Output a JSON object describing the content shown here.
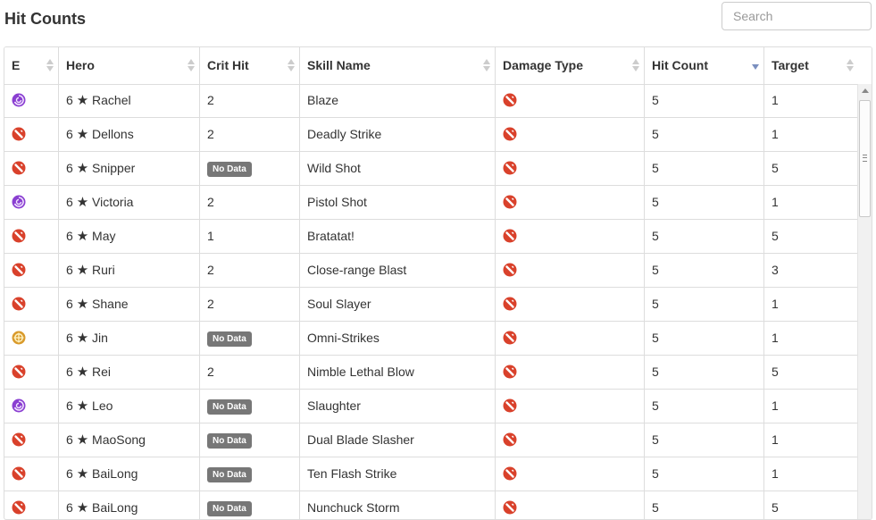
{
  "page": {
    "title": "Hit Counts"
  },
  "search": {
    "placeholder": "Search"
  },
  "columns": [
    {
      "key": "element",
      "label": "E"
    },
    {
      "key": "hero",
      "label": "Hero"
    },
    {
      "key": "crit",
      "label": "Crit Hit"
    },
    {
      "key": "skill",
      "label": "Skill Name"
    },
    {
      "key": "damage",
      "label": "Damage Type"
    },
    {
      "key": "hits",
      "label": "Hit Count",
      "sort": "desc"
    },
    {
      "key": "target",
      "label": "Target"
    }
  ],
  "element_icons": {
    "dark": {
      "icon": "dark-element-icon",
      "color": "#8a3fd1"
    },
    "physical": {
      "icon": "physical-element-icon",
      "color": "#d9412b"
    },
    "light": {
      "icon": "light-element-icon",
      "color": "#d99a2b"
    }
  },
  "damage_icon": {
    "icon": "physical-damage-icon",
    "color": "#d9412b"
  },
  "rows": [
    {
      "element": "dark",
      "stars": "6",
      "hero": "Rachel",
      "crit": "2",
      "skill": "Blaze",
      "hits": "5",
      "target": "1"
    },
    {
      "element": "physical",
      "stars": "6",
      "hero": "Dellons",
      "crit": "2",
      "skill": "Deadly Strike",
      "hits": "5",
      "target": "1"
    },
    {
      "element": "physical",
      "stars": "6",
      "hero": "Snipper",
      "crit": "No Data",
      "skill": "Wild Shot",
      "hits": "5",
      "target": "5"
    },
    {
      "element": "dark",
      "stars": "6",
      "hero": "Victoria",
      "crit": "2",
      "skill": "Pistol Shot",
      "hits": "5",
      "target": "1"
    },
    {
      "element": "physical",
      "stars": "6",
      "hero": "May",
      "crit": "1",
      "skill": "Bratatat!",
      "hits": "5",
      "target": "5"
    },
    {
      "element": "physical",
      "stars": "6",
      "hero": "Ruri",
      "crit": "2",
      "skill": "Close-range Blast",
      "hits": "5",
      "target": "3"
    },
    {
      "element": "physical",
      "stars": "6",
      "hero": "Shane",
      "crit": "2",
      "skill": "Soul Slayer",
      "hits": "5",
      "target": "1"
    },
    {
      "element": "light",
      "stars": "6",
      "hero": "Jin",
      "crit": "No Data",
      "skill": "Omni-Strikes",
      "hits": "5",
      "target": "1"
    },
    {
      "element": "physical",
      "stars": "6",
      "hero": "Rei",
      "crit": "2",
      "skill": "Nimble Lethal Blow",
      "hits": "5",
      "target": "5"
    },
    {
      "element": "dark",
      "stars": "6",
      "hero": "Leo",
      "crit": "No Data",
      "skill": "Slaughter",
      "hits": "5",
      "target": "1"
    },
    {
      "element": "physical",
      "stars": "6",
      "hero": "MaoSong",
      "crit": "No Data",
      "skill": "Dual Blade Slasher",
      "hits": "5",
      "target": "1"
    },
    {
      "element": "physical",
      "stars": "6",
      "hero": "BaiLong",
      "crit": "No Data",
      "skill": "Ten Flash Strike",
      "hits": "5",
      "target": "1"
    },
    {
      "element": "physical",
      "stars": "6",
      "hero": "BaiLong",
      "crit": "No Data",
      "skill": "Nunchuck Storm",
      "hits": "5",
      "target": "5"
    }
  ]
}
